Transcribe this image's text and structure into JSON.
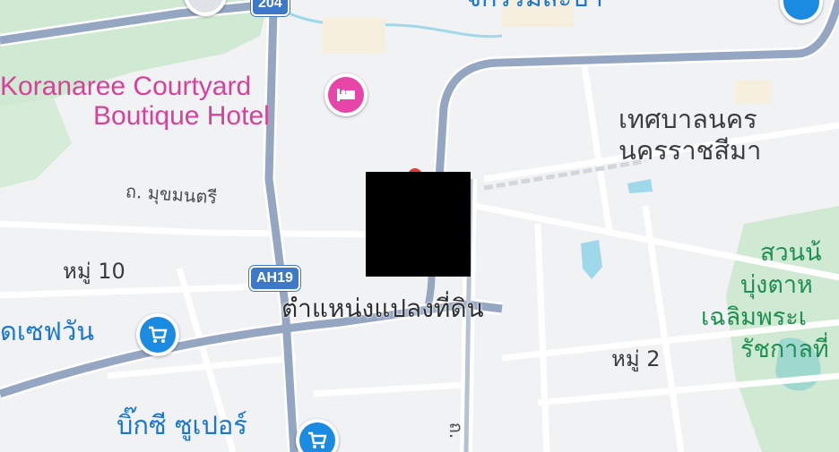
{
  "map": {
    "road_shield": "AH19",
    "road_shield_top": "204",
    "hotel": {
      "line1": "Koranaree Courtyard",
      "line2": "Boutique Hotel",
      "icon": "bed-icon",
      "color": "#e845a8"
    },
    "municipality": {
      "line1": "เทศบาลนคร",
      "line2": "นครราชสีมา"
    },
    "road_label": "ถ. มุขมนตรี",
    "road_label_vertical": "ถ.",
    "village_left": "หมู่ 10",
    "village_right": "หมู่ 2",
    "store_left": {
      "label": "ดเซฟวัน",
      "icon": "shopping-cart-icon",
      "color": "#1a8be0"
    },
    "store_bottom": {
      "label": "บิ๊กซี ซูเปอร์",
      "icon": "shopping-cart-icon",
      "color": "#1a8be0"
    },
    "park": {
      "line1": "สวนน้",
      "line2": "บุ่งตาห",
      "line3": "เฉลิมพระเ",
      "line4": "รัชกาลที่"
    },
    "top_cut_label": "จกรรมสะบา",
    "location_label": "ตำแหน่งแปลงที่ดิน",
    "redacted_marker": "redacted-block"
  }
}
